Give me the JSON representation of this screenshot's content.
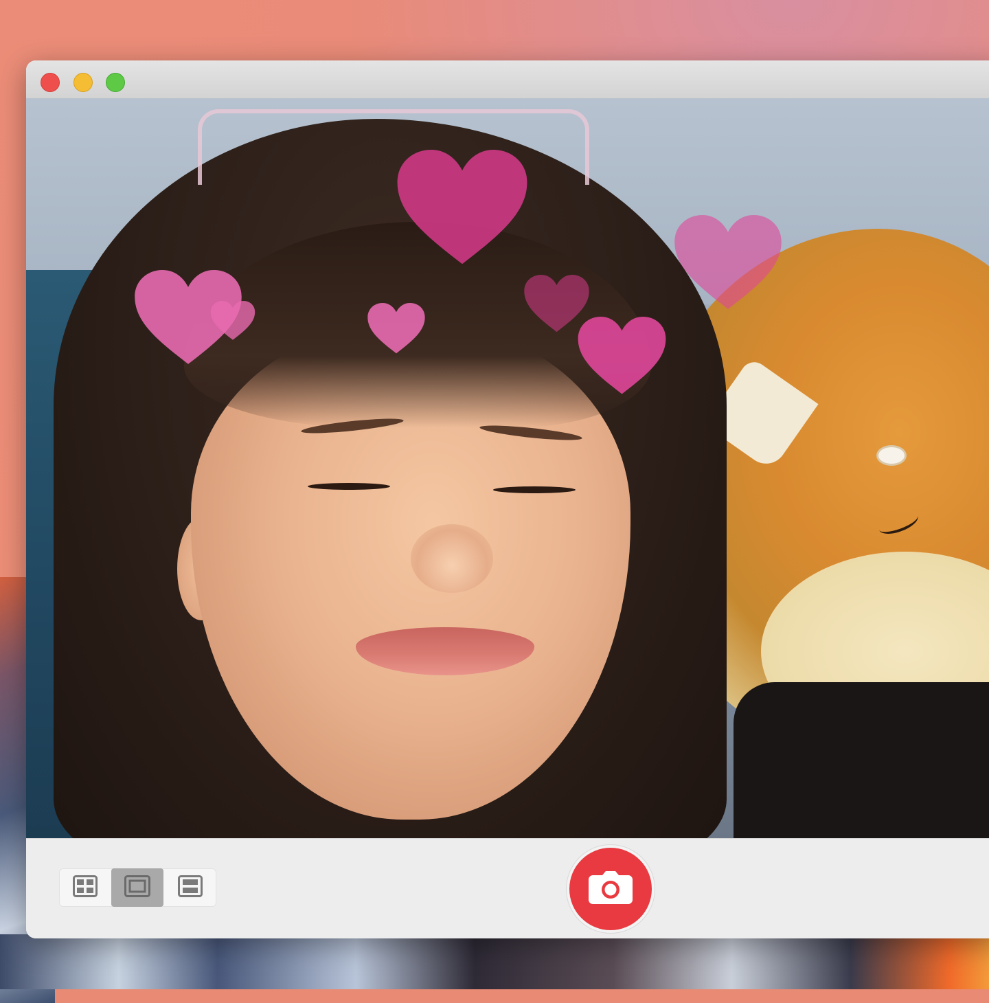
{
  "app": {
    "window_controls": [
      "close",
      "minimize",
      "zoom"
    ]
  },
  "viewport": {
    "effect": "hearts-crown",
    "heart_colors": [
      "#e0479a",
      "#d83a8c",
      "#e86ab0"
    ]
  },
  "toolbar": {
    "view_modes": [
      {
        "icon": "grid-view-icon",
        "selected": false
      },
      {
        "icon": "single-view-icon",
        "selected": true
      },
      {
        "icon": "filmstrip-view-icon",
        "selected": false
      }
    ],
    "capture_icon": "camera-icon",
    "accent_color": "#e83a40"
  }
}
